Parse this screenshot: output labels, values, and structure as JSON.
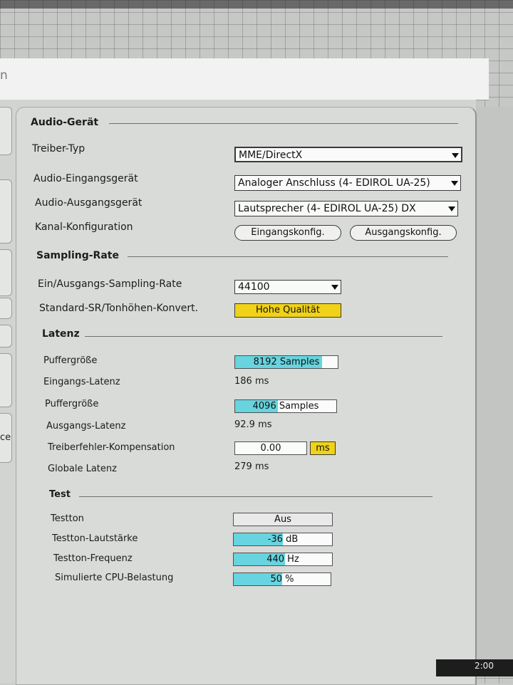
{
  "window": {
    "title_partial": "n"
  },
  "side": {
    "partial_label": "ce"
  },
  "status": {
    "time": "2:00"
  },
  "audio_device": {
    "heading": "Audio-Gerät",
    "driver_type": {
      "label": "Treiber-Typ",
      "value": "MME/DirectX"
    },
    "input_device": {
      "label": "Audio-Eingangsgerät",
      "value": "Analoger Anschluss (4- EDIROL UA-25)"
    },
    "output_device": {
      "label": "Audio-Ausgangsgerät",
      "value": "Lautsprecher (4- EDIROL UA-25) DX"
    },
    "channel_config": {
      "label": "Kanal-Konfiguration",
      "input_button": "Eingangskonfig.",
      "output_button": "Ausgangskonfig."
    }
  },
  "sampling_rate": {
    "heading": "Sampling-Rate",
    "io_rate": {
      "label": "Ein/Ausgangs-Sampling-Rate",
      "value": "44100"
    },
    "conversion": {
      "label": "Standard-SR/Tonhöhen-Konvert.",
      "value": "Hohe Qualität"
    }
  },
  "latency": {
    "heading": "Latenz",
    "buffer_in": {
      "label": "Puffergröße",
      "value": "8192 Samples",
      "fill": 0.85
    },
    "input_latency": {
      "label": "Eingangs-Latenz",
      "value": "186 ms"
    },
    "buffer_out": {
      "label": "Puffergröße",
      "value": "4096 Samples",
      "fill": 0.42
    },
    "output_latency": {
      "label": "Ausgangs-Latenz",
      "value": "92.9 ms"
    },
    "driver_error_comp": {
      "label": "Treiberfehler-Kompensation",
      "value": "0.00",
      "unit": "ms"
    },
    "overall_latency": {
      "label": "Globale Latenz",
      "value": "279 ms"
    }
  },
  "test": {
    "heading": "Test",
    "tone": {
      "label": "Testton",
      "value": "Aus"
    },
    "volume": {
      "label": "Testton-Lautstärke",
      "value": "-36 dB",
      "fill": 0.5
    },
    "frequency": {
      "label": "Testton-Frequenz",
      "value": "440 Hz",
      "fill": 0.52
    },
    "cpu_load": {
      "label": "Simulierte CPU-Belastung",
      "value": "50 %",
      "fill": 0.5
    }
  },
  "colors": {
    "accent_fill": "#67d4df",
    "highlight": "#f0d218"
  }
}
